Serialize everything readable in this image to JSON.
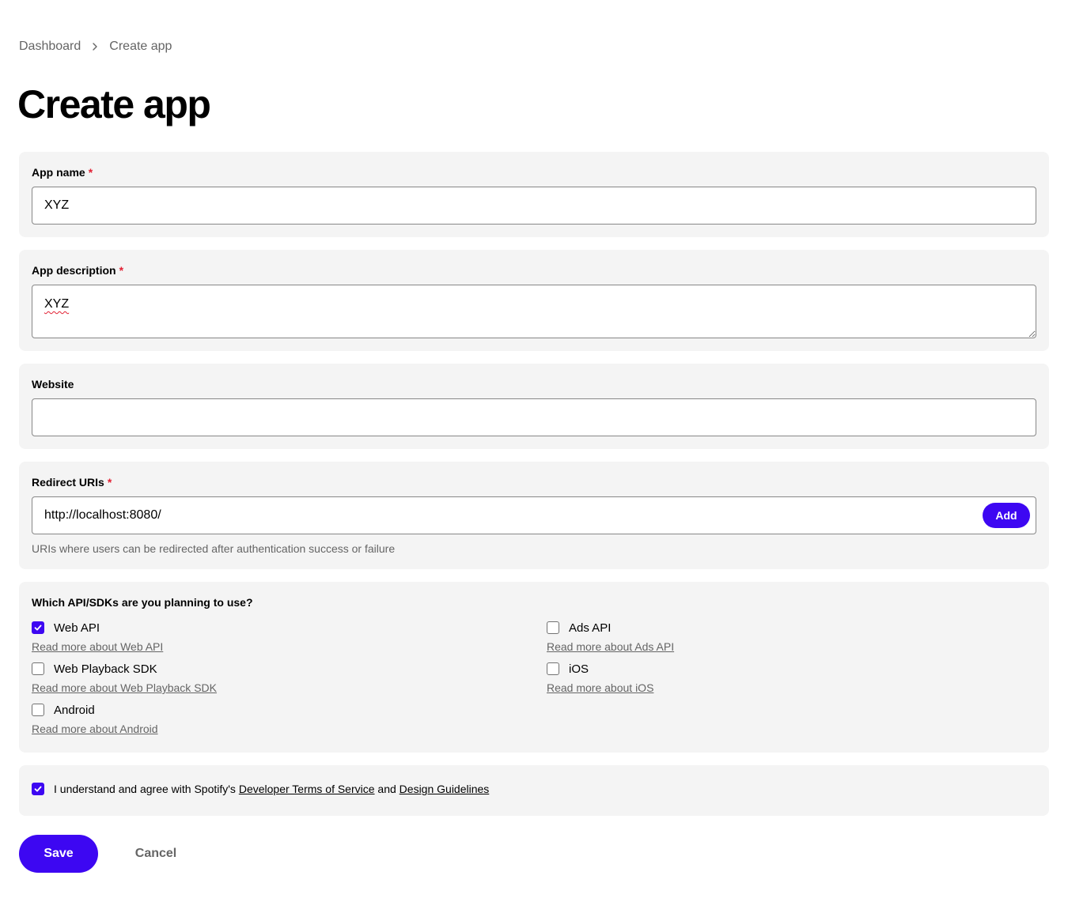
{
  "breadcrumb": {
    "items": [
      "Dashboard",
      "Create app"
    ],
    "separator_icon": "chevron-right-icon"
  },
  "page_title": "Create app",
  "required_marker": "*",
  "fields": {
    "app_name": {
      "label": "App name",
      "value": "XYZ",
      "required": true
    },
    "app_description": {
      "label": "App description",
      "value": "XYZ",
      "required": true
    },
    "website": {
      "label": "Website",
      "value": "",
      "required": false
    },
    "redirect_uris": {
      "label": "Redirect URIs",
      "value": "http://localhost:8080/",
      "required": true,
      "add_label": "Add",
      "helper": "URIs where users can be redirected after authentication success or failure"
    }
  },
  "apis": {
    "heading": "Which API/SDKs are you planning to use?",
    "options": [
      {
        "label": "Web API",
        "checked": true,
        "link": "Read more about Web API"
      },
      {
        "label": "Web Playback SDK",
        "checked": false,
        "link": "Read more about Web Playback SDK"
      },
      {
        "label": "Android",
        "checked": false,
        "link": "Read more about Android"
      },
      {
        "label": "Ads API",
        "checked": false,
        "link": "Read more about Ads API"
      },
      {
        "label": "iOS",
        "checked": false,
        "link": "Read more about iOS"
      }
    ]
  },
  "terms": {
    "checked": true,
    "prefix": "I understand and agree with Spotify's ",
    "terms_link": "Developer Terms of Service",
    "conjunction": " and ",
    "guidelines_link": "Design Guidelines"
  },
  "actions": {
    "save_label": "Save",
    "cancel_label": "Cancel"
  },
  "colors": {
    "accent": "#3d07f2",
    "required": "#e22134",
    "card_background": "#f4f4f4",
    "muted_text": "#656565"
  }
}
